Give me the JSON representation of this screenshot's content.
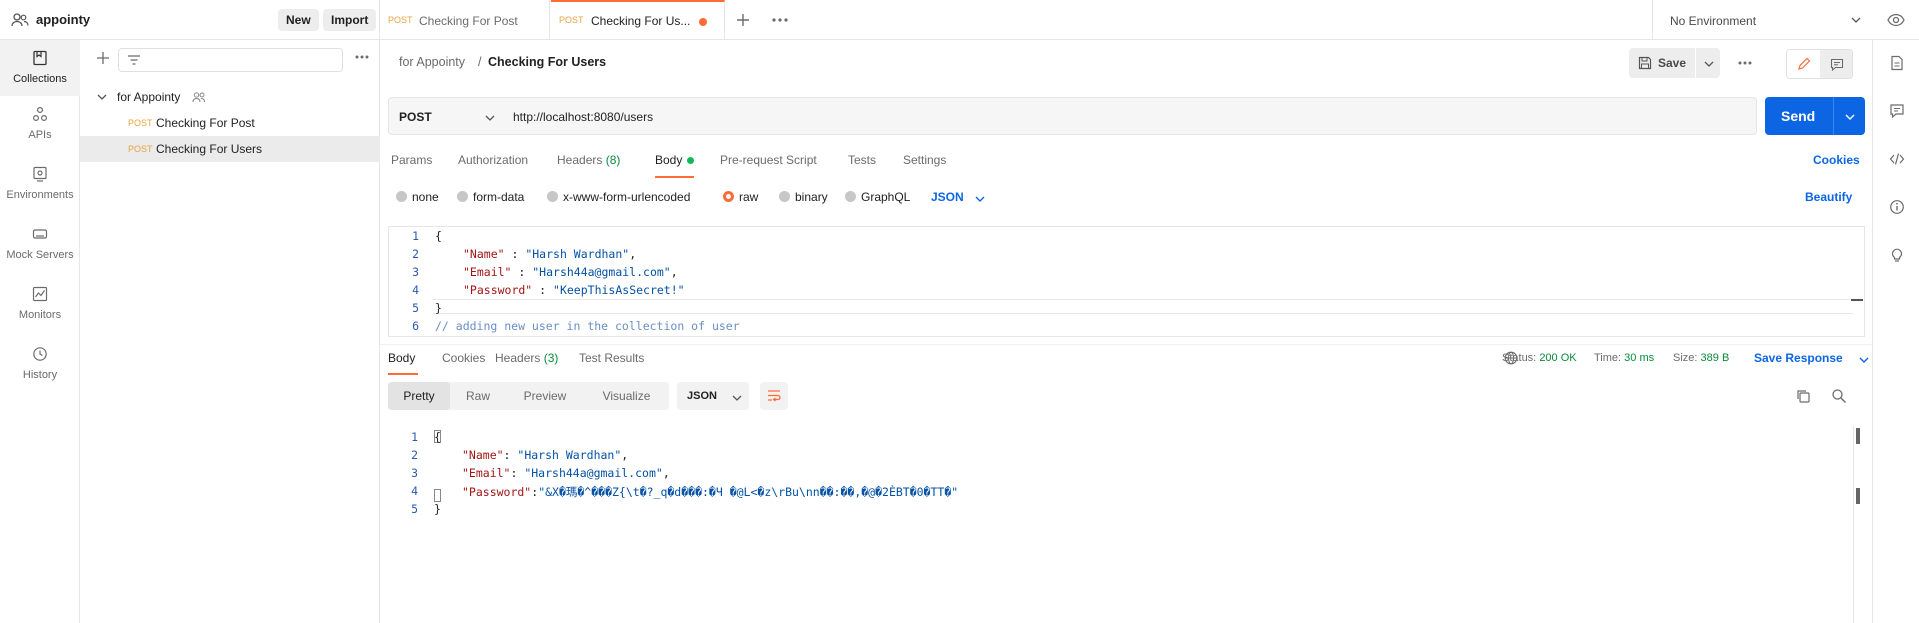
{
  "workspace": {
    "name": "appointy",
    "new_label": "New",
    "import_label": "Import"
  },
  "tabs": [
    {
      "method": "POST",
      "title": "Checking For Post"
    },
    {
      "method": "POST",
      "title": "Checking For Us..."
    }
  ],
  "environment": {
    "label": "No Environment"
  },
  "rail": [
    {
      "label": "Collections",
      "icon": "collections-icon"
    },
    {
      "label": "APIs",
      "icon": "apis-icon"
    },
    {
      "label": "Environments",
      "icon": "environments-icon"
    },
    {
      "label": "Mock Servers",
      "icon": "mock-servers-icon"
    },
    {
      "label": "Monitors",
      "icon": "monitors-icon"
    },
    {
      "label": "History",
      "icon": "history-icon"
    }
  ],
  "sidebar": {
    "folder": "for Appointy",
    "requests": [
      {
        "method": "POST",
        "name": "Checking For Post"
      },
      {
        "method": "POST",
        "name": "Checking For Users"
      }
    ]
  },
  "breadcrumb": {
    "parent": "for Appointy",
    "separator": "/",
    "current": "Checking For Users"
  },
  "toolbar": {
    "save_label": "Save"
  },
  "request": {
    "method": "POST",
    "url": "http://localhost:8080/users",
    "send_label": "Send",
    "tabs": {
      "params": "Params",
      "authorization": "Authorization",
      "headers": "Headers",
      "headers_count": "(8)",
      "body": "Body",
      "prerequest": "Pre-request Script",
      "tests": "Tests",
      "settings": "Settings"
    },
    "cookies_label": "Cookies",
    "body_types": [
      "none",
      "form-data",
      "x-www-form-urlencoded",
      "raw",
      "binary",
      "GraphQL"
    ],
    "body_type_selected": "raw",
    "language": "JSON",
    "beautify_label": "Beautify",
    "body_lines": {
      "n": [
        "1",
        "2",
        "3",
        "4",
        "5",
        "6"
      ],
      "l1": "{",
      "l2_key": "\"Name\"",
      "l2_sep": " : ",
      "l2_val": "\"Harsh Wardhan\"",
      "l2_end": ",",
      "l3_key": "\"Email\"",
      "l3_sep": " : ",
      "l3_val": "\"Harsh44a@gmail.com\"",
      "l3_end": ",",
      "l4_key": "\"Password\"",
      "l4_sep": " : ",
      "l4_val": "\"KeepThisAsSecret!\"",
      "l5": "}",
      "l6": "// adding new user in the collection of user"
    }
  },
  "response": {
    "tabs": {
      "body": "Body",
      "cookies": "Cookies",
      "headers": "Headers",
      "headers_count": "(3)",
      "test_results": "Test Results"
    },
    "status_label": "Status:",
    "status_value": "200 OK",
    "time_label": "Time:",
    "time_value": "30 ms",
    "size_label": "Size:",
    "size_value": "389 B",
    "save_response_label": "Save Response",
    "views": [
      "Pretty",
      "Raw",
      "Preview",
      "Visualize"
    ],
    "language": "JSON",
    "body_lines": {
      "n": [
        "1",
        "2",
        "3",
        "4",
        "5"
      ],
      "l1": "{",
      "l2_key": "\"Name\"",
      "l2_sep": ": ",
      "l2_val": "\"Harsh Wardhan\"",
      "l2_end": ",",
      "l3_key": "\"Email\"",
      "l3_sep": ": ",
      "l3_val": "\"Harsh44a@gmail.com\"",
      "l3_end": ",",
      "l4_key": "\"Password\"",
      "l4_sep": ":",
      "l4_val": "\"\u0011&X�瑪�^\u0007��\u0014�Z{\\t�?_q\u0014�d���:�Ч �@L<�z\\rBu\\nn��:��,�@�2ÈB\u0007T�0�TT�\"",
      "l5": "}"
    }
  },
  "colors": {
    "accent": "#ff6c37",
    "primary": "#0c66e4",
    "method_post": "#e8a33d",
    "success": "#0a8a3a"
  }
}
